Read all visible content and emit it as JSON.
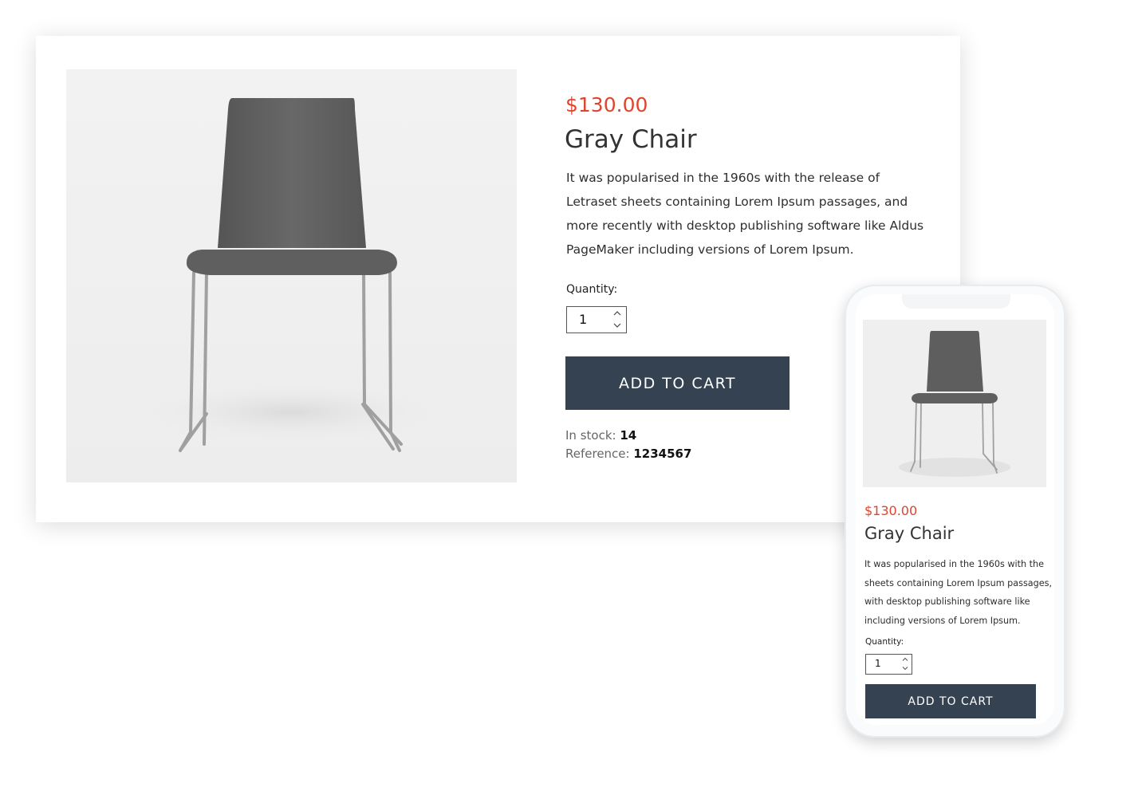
{
  "product": {
    "price": "$130.00",
    "name": "Gray Chair",
    "description": "It was popularised in the 1960s with the release of Letraset sheets containing Lorem Ipsum passages, and more recently with desktop publishing software like Aldus PageMaker including versions of Lorem Ipsum.",
    "quantity_label": "Quantity:",
    "quantity_value": "1",
    "add_to_cart_label": "ADD TO CART",
    "stock_label": "In stock:",
    "stock_value": "14",
    "reference_label": "Reference:",
    "reference_value": "1234567"
  },
  "mobile": {
    "price": "$130.00",
    "name": "Gray Chair",
    "description": "It was popularised in the 1960s with the sheets containing Lorem Ipsum passages, with desktop publishing software like including versions of Lorem Ipsum.",
    "quantity_label": "Quantity:",
    "quantity_value": "1",
    "add_to_cart_label": "ADD TO CART"
  },
  "colors": {
    "price": "#e0442c",
    "button": "#344252",
    "chair_fabric": "#5c5c5c",
    "chair_legs": "#9a9a9a"
  },
  "icons": {
    "spin_up": "chevron-up-icon",
    "spin_down": "chevron-down-icon"
  }
}
